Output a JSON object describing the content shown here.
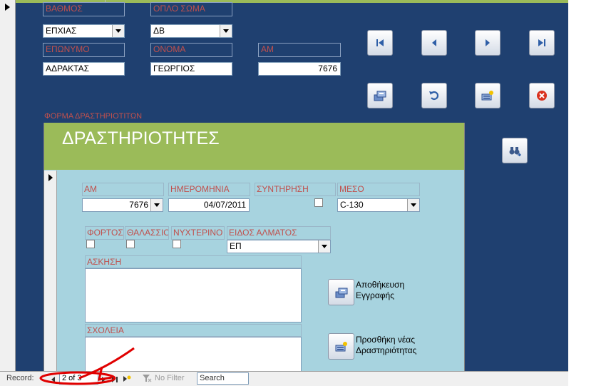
{
  "main_form": {
    "fields": [
      {
        "label": "ΒΑΘΜΟΣ",
        "value": "ΕΠΧΙΑΣ",
        "dropdown": true
      },
      {
        "label": "ΟΠΛΟ ΣΩΜΑ",
        "value": "ΔΒ",
        "dropdown": true
      },
      {
        "label": "ΕΠΩΝΥΜΟ",
        "value": "ΑΔΡΑΚΤΑΣ"
      },
      {
        "label": "ΟΝΟΜΑ",
        "value": "ΓΕΩΡΓΙΟΣ"
      },
      {
        "label": "ΑΜ",
        "value": "7676"
      }
    ],
    "buttons": [
      {
        "name": "first-record-button",
        "icon": "first-record-icon"
      },
      {
        "name": "previous-record-button",
        "icon": "previous-record-icon"
      },
      {
        "name": "next-record-button",
        "icon": "next-record-icon"
      },
      {
        "name": "last-record-button",
        "icon": "last-record-icon"
      },
      {
        "name": "save-record-button",
        "icon": "save-icon"
      },
      {
        "name": "undo-button",
        "icon": "undo-icon"
      },
      {
        "name": "add-record-button",
        "icon": "add-record-icon"
      },
      {
        "name": "delete-record-button",
        "icon": "delete-icon"
      },
      {
        "name": "find-record-button",
        "icon": "binoculars-icon"
      }
    ],
    "subform_caption": "ΦΟΡΜΑ ΔΡΑΣΤΗΡΙΟΤΙΤΩΝ"
  },
  "subform": {
    "title": "ΔΡΑΣΤΗΡΙΟΤΗΤΕΣ",
    "am": {
      "label": "ΑΜ",
      "value": "7676"
    },
    "date": {
      "label": "ΗΜΕΡΟΜΗΝΙΑ",
      "value": "04/07/2011"
    },
    "maintenance": {
      "label": "ΣΥΝΤΗΡΗΣΗ",
      "checked": false
    },
    "means": {
      "label": "ΜΕΣΟ",
      "value": "C-130"
    },
    "load": {
      "label": "ΦΟΡΤΟΣ",
      "checked": false
    },
    "sea": {
      "label": "ΘΑΛΑΣΣΙΟ",
      "checked": false
    },
    "night": {
      "label": "ΝΥΧΤΕΡΙΝΟ",
      "checked": false
    },
    "jump_type": {
      "label": "ΕΙΔΟΣ ΑΛΜΑΤΟΣ",
      "value": "ΕΠ"
    },
    "exercise": {
      "label": "ΑΣΚΗΣΗ",
      "value": ""
    },
    "schools": {
      "label": "ΣΧΟΛΕΙΑ",
      "value": ""
    },
    "save_button": {
      "line1": "Αποθήκευση",
      "line2": "Εγγραφής",
      "icon": "save-icon"
    },
    "add_button": {
      "line1": "Προσθήκη νέας",
      "line2": "Δραστηριότητας",
      "icon": "add-record-icon"
    }
  },
  "record_nav": {
    "label": "Record:",
    "current": "2 of 3",
    "filter_label": "No Filter",
    "search_label": "Search"
  },
  "colors": {
    "form_background": "#1f4070",
    "label_text": "#c0504d",
    "header_green": "#9bbb59",
    "subform_background": "#a7d3df",
    "annotation_red": "#e00000"
  }
}
